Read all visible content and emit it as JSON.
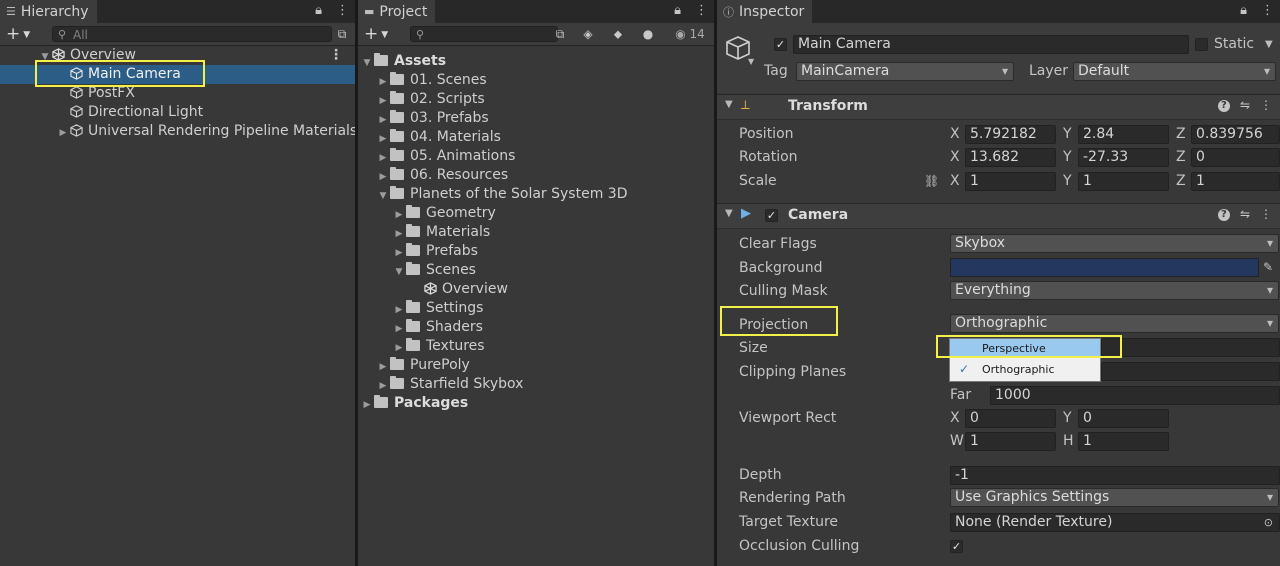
{
  "hierarchy": {
    "tab_title": "Hierarchy",
    "search_placeholder": "All",
    "items": [
      {
        "label": "Overview"
      },
      {
        "label": "Main Camera"
      },
      {
        "label": "PostFX"
      },
      {
        "label": "Directional Light"
      },
      {
        "label": "Universal Rendering Pipeline Materials"
      }
    ]
  },
  "project": {
    "tab_title": "Project",
    "hidden_count": "14",
    "tree": [
      {
        "label": "Assets"
      },
      {
        "label": "01. Scenes"
      },
      {
        "label": "02. Scripts"
      },
      {
        "label": "03. Prefabs"
      },
      {
        "label": "04. Materials"
      },
      {
        "label": "05. Animations"
      },
      {
        "label": "06. Resources"
      },
      {
        "label": "Planets of the Solar System 3D"
      },
      {
        "label": "Geometry"
      },
      {
        "label": "Materials"
      },
      {
        "label": "Prefabs"
      },
      {
        "label": "Scenes"
      },
      {
        "label": "Overview"
      },
      {
        "label": "Settings"
      },
      {
        "label": "Shaders"
      },
      {
        "label": "Textures"
      },
      {
        "label": "PurePoly"
      },
      {
        "label": "Starfield Skybox"
      },
      {
        "label": "Packages"
      }
    ]
  },
  "inspector": {
    "tab_title": "Inspector",
    "object_name": "Main Camera",
    "static_label": "Static",
    "tag_label": "Tag",
    "tag_value": "MainCamera",
    "layer_label": "Layer",
    "layer_value": "Default",
    "transform": {
      "title": "Transform",
      "position_label": "Position",
      "rotation_label": "Rotation",
      "scale_label": "Scale",
      "axis_x": "X",
      "axis_y": "Y",
      "axis_z": "Z",
      "position": {
        "x": "5.792182",
        "y": "2.84",
        "z": "0.839756"
      },
      "rotation": {
        "x": "13.682",
        "y": "-27.33",
        "z": "0"
      },
      "scale": {
        "x": "1",
        "y": "1",
        "z": "1"
      }
    },
    "camera": {
      "title": "Camera",
      "clear_flags_label": "Clear Flags",
      "clear_flags_value": "Skybox",
      "background_label": "Background",
      "background_color": "#24375e",
      "culling_mask_label": "Culling Mask",
      "culling_mask_value": "Everything",
      "projection_label": "Projection",
      "projection_value": "Orthographic",
      "size_label": "Size",
      "clipping_planes_label": "Clipping Planes",
      "far_label": "Far",
      "far_value": "1000",
      "viewport_rect_label": "Viewport Rect",
      "axis_w": "W",
      "axis_h": "H",
      "viewport": {
        "x": "0",
        "y": "0",
        "w": "1",
        "h": "1"
      },
      "depth_label": "Depth",
      "depth_value": "-1",
      "rendering_path_label": "Rendering Path",
      "rendering_path_value": "Use Graphics Settings",
      "target_texture_label": "Target Texture",
      "target_texture_value": "None (Render Texture)",
      "occlusion_culling_label": "Occlusion Culling"
    },
    "projection_popup": {
      "options": [
        {
          "label": "Perspective"
        },
        {
          "label": "Orthographic"
        }
      ]
    }
  },
  "colors": {
    "selection": "#2c5d87",
    "highlight_box": "#f3f04a",
    "popup_hover": "#9ac9ef"
  }
}
